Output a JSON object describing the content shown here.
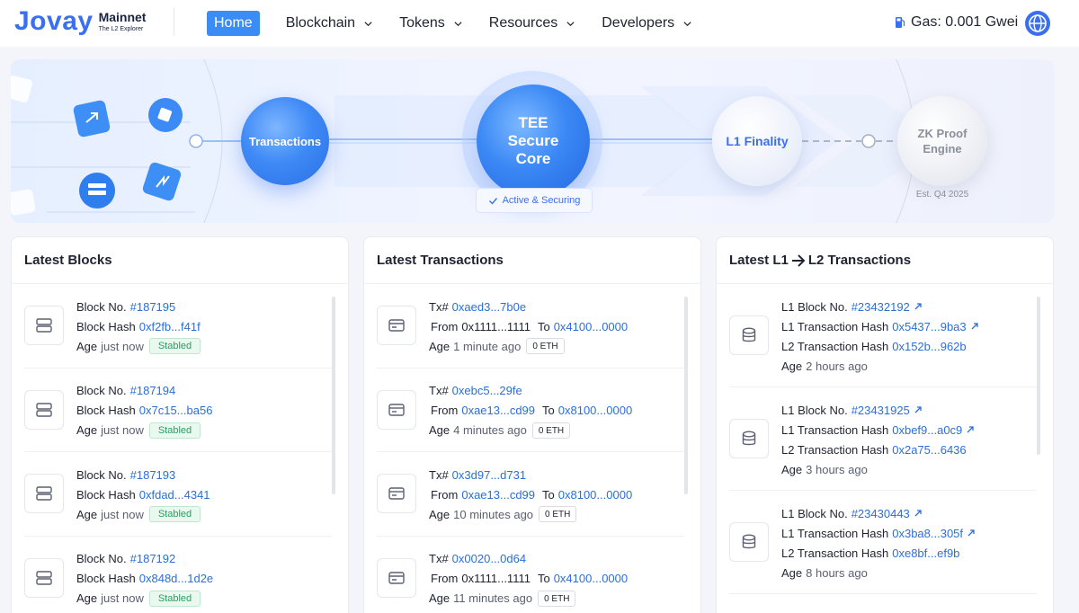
{
  "header": {
    "logo_word": "Jovay",
    "logo_network": "Mainnet",
    "logo_tagline": "The L2 Explorer",
    "nav": {
      "home": "Home",
      "items": [
        "Blockchain",
        "Tokens",
        "Resources",
        "Developers"
      ]
    },
    "gas_label": "Gas: 0.001 Gwei",
    "icons": {
      "gas": "gas-pump-icon",
      "globe": "language-globe-icon"
    }
  },
  "hero": {
    "stage1": "Transactions",
    "stage2_line1": "TEE",
    "stage2_line2": "Secure",
    "stage2_line3": "Core",
    "stage2_badge": "Active & Securing",
    "stage3": "L1 Finality",
    "stage4_line1": "ZK Proof",
    "stage4_line2": "Engine",
    "stage4_note": "Est. Q4 2025"
  },
  "blocks": {
    "title": "Latest Blocks",
    "labels": {
      "block_no": "Block No.",
      "block_hash": "Block Hash",
      "age": "Age"
    },
    "items": [
      {
        "number": "#187195",
        "hash": "0xf2fb...f41f",
        "age": "just now",
        "status": "Stabled"
      },
      {
        "number": "#187194",
        "hash": "0x7c15...ba56",
        "age": "just now",
        "status": "Stabled"
      },
      {
        "number": "#187193",
        "hash": "0xfdad...4341",
        "age": "just now",
        "status": "Stabled"
      },
      {
        "number": "#187192",
        "hash": "0x848d...1d2e",
        "age": "just now",
        "status": "Stabled"
      }
    ]
  },
  "transactions": {
    "title": "Latest Transactions",
    "labels": {
      "tx": "Tx#",
      "from": "From",
      "to": "To",
      "age": "Age"
    },
    "items": [
      {
        "hash": "0xaed3...7b0e",
        "from": "0x1111...1111",
        "to": "0x4100...0000",
        "age": "1 minute ago",
        "value": "0 ETH",
        "from_link": false
      },
      {
        "hash": "0xebc5...29fe",
        "from": "0xae13...cd99",
        "to": "0x8100...0000",
        "age": "4 minutes ago",
        "value": "0 ETH",
        "from_link": true
      },
      {
        "hash": "0x3d97...d731",
        "from": "0xae13...cd99",
        "to": "0x8100...0000",
        "age": "10 minutes ago",
        "value": "0 ETH",
        "from_link": true
      },
      {
        "hash": "0x0020...0d64",
        "from": "0x1111...1111",
        "to": "0x4100...0000",
        "age": "11 minutes ago",
        "value": "0 ETH",
        "from_link": false
      }
    ]
  },
  "l1l2": {
    "title_left": "Latest L1",
    "title_right": "L2 Transactions",
    "labels": {
      "l1_block": "L1 Block No.",
      "l1_hash": "L1 Transaction Hash",
      "l2_hash": "L2 Transaction Hash",
      "age": "Age"
    },
    "items": [
      {
        "l1_block": "#23432192",
        "l1_hash": "0x5437...9ba3",
        "l2_hash": "0x152b...962b",
        "age": "2 hours ago"
      },
      {
        "l1_block": "#23431925",
        "l1_hash": "0xbef9...a0c9",
        "l2_hash": "0x2a75...6436",
        "age": "3 hours ago"
      },
      {
        "l1_block": "#23430443",
        "l1_hash": "0x3ba8...305f",
        "l2_hash": "0xe8bf...ef9b",
        "age": "8 hours ago"
      }
    ]
  },
  "colors": {
    "accent": "#3a6ff2",
    "link": "#2a6fd8",
    "home_button": "#3b8df5",
    "stabled": "#23a25f"
  }
}
